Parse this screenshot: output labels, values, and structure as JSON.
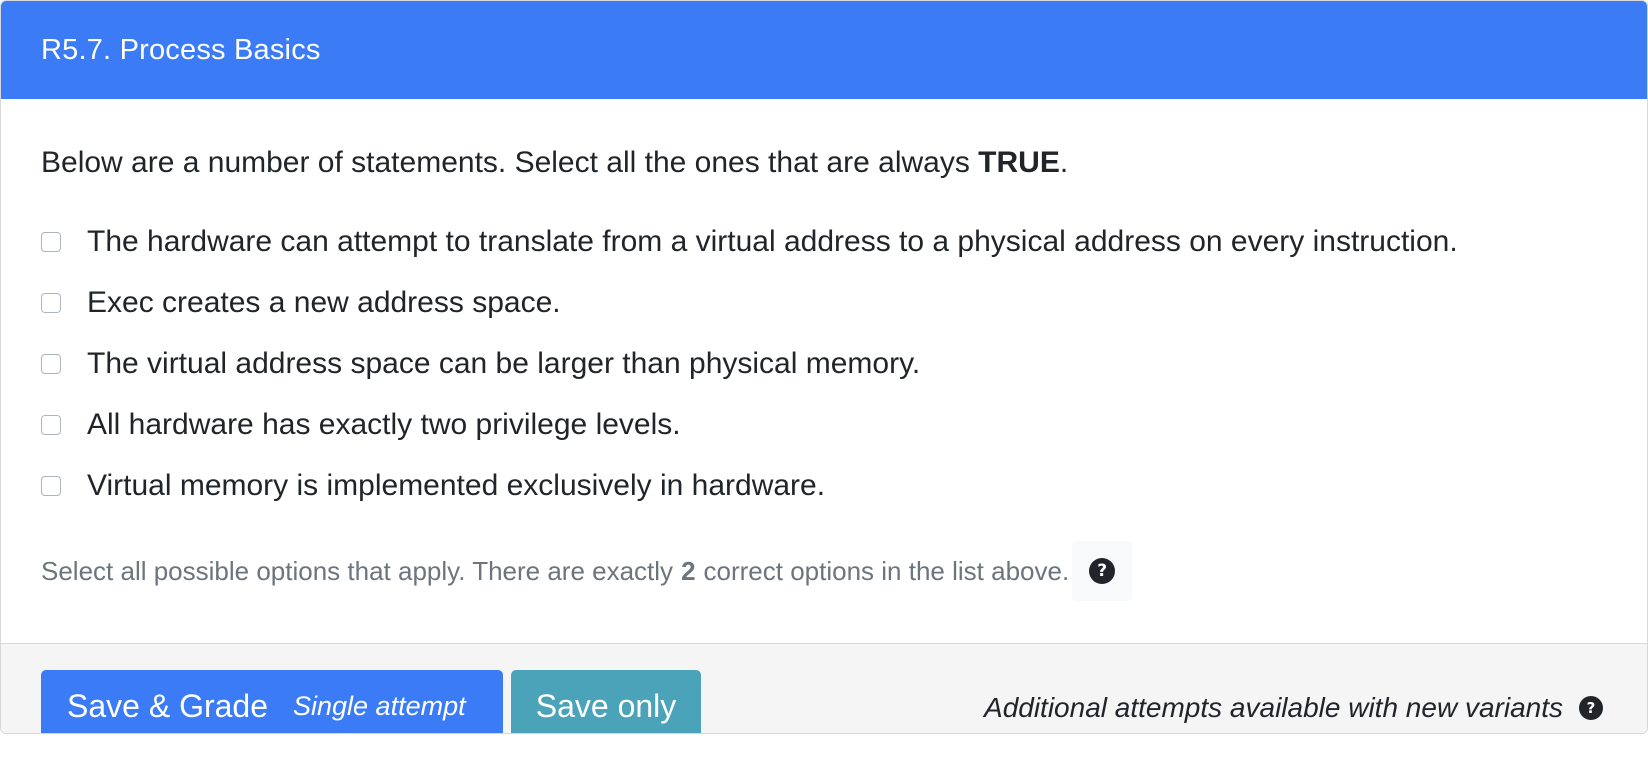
{
  "header": {
    "title": "R5.7. Process Basics"
  },
  "question": {
    "prompt_prefix": "Below are a number of statements. Select all the ones that are always ",
    "prompt_bold": "TRUE",
    "prompt_suffix": ".",
    "options": [
      {
        "label": "The hardware can attempt to translate from a virtual address to a physical address on every instruction.",
        "checked": false
      },
      {
        "label": "Exec creates a new address space.",
        "checked": false
      },
      {
        "label": "The virtual address space can be larger than physical memory.",
        "checked": false
      },
      {
        "label": "All hardware has exactly two privilege levels.",
        "checked": false
      },
      {
        "label": "Virtual memory is implemented exclusively in hardware.",
        "checked": false
      }
    ],
    "hint_prefix": "Select all possible options that apply. There are exactly",
    "hint_count": "2",
    "hint_suffix": "correct options in the list above.",
    "help_icon": "question-circle-icon"
  },
  "footer": {
    "grade_button": "Save & Grade",
    "grade_sub": "Single attempt",
    "save_button": "Save only",
    "attempts_text": "Additional attempts available with new variants",
    "help_icon": "question-circle-icon"
  },
  "colors": {
    "primary": "#3b7cf6",
    "info": "#4aa3b8",
    "muted": "#6c757d"
  }
}
